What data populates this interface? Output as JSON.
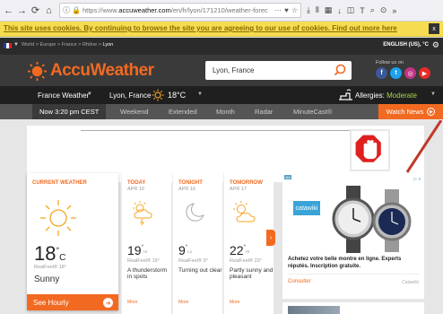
{
  "browser": {
    "url_prefix": "https://www.",
    "url_domain": "accuweather.com",
    "url_path": "/en/fr/lyon/171210/weather-forec"
  },
  "cookie": {
    "message": "This site uses cookies. By continuing to browse the site you are agreeing to our use of cookies. Find out more here",
    "close": "x"
  },
  "breadcrumb": {
    "items": [
      "World",
      "Europe",
      "France",
      "Rhône",
      "Lyon"
    ],
    "separator": " > ",
    "locale": "ENGLISH (US), °C"
  },
  "header": {
    "logo": "AccuWeather",
    "search_value": "Lyon, France",
    "follow": "Follow us on"
  },
  "location": {
    "country": "France Weather",
    "city": "Lyon, France",
    "temp": "18°C",
    "allergies_label": "Allergies: ",
    "allergies_value": "Moderate"
  },
  "tabs": [
    "Now 3:20 pm CEST",
    "Weekend",
    "Extended",
    "Month",
    "Radar",
    "MinuteCast®"
  ],
  "watch_news": "Watch News",
  "current": {
    "title": "CURRENT WEATHER",
    "temp": "18",
    "unit": "C",
    "deg": "°",
    "realfeel": "RealFeel® 18°",
    "phrase": "Sunny",
    "see_hourly": "See Hourly"
  },
  "forecast": [
    {
      "title": "TODAY",
      "date": "APR 16",
      "temp": "19",
      "deg": "°",
      "hilo": "Hi",
      "realfeel": "RealFeel® 19°",
      "phrase": "A thunderstorm in spots",
      "more": "More"
    },
    {
      "title": "TONIGHT",
      "date": "APR 16",
      "temp": "9",
      "deg": "°",
      "hilo": "Lo",
      "realfeel": "RealFeel® 9°",
      "phrase": "Turning out clear",
      "more": "More"
    },
    {
      "title": "TOMORROW",
      "date": "APR 17",
      "temp": "22",
      "deg": "°",
      "hilo": "Hi",
      "realfeel": "RealFeel® 23°",
      "phrase": "Partly sunny and pleasant",
      "more": "More"
    }
  ],
  "ad": {
    "label": "Ad",
    "choice": "▷ x",
    "brand": "catawiki",
    "headline": "Achetez votre belle montre en ligne. Experts réputés. Inscription gratuite.",
    "cta": "Consulter",
    "source": "Catawiki"
  },
  "icons": {
    "back": "back-arrow-icon",
    "forward": "forward-arrow-icon",
    "reload": "reload-icon",
    "home": "home-icon"
  },
  "colors": {
    "brand": "#f26a21",
    "cookie_bg": "#f5dc50",
    "header_bg": "#3a3a3a",
    "allergy_moderate": "#a8d64a"
  }
}
